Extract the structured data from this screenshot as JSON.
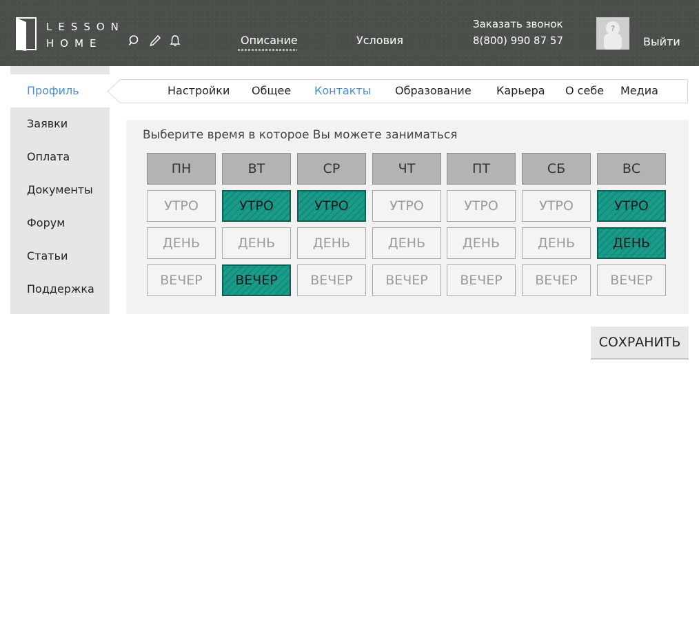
{
  "header": {
    "logo_line1": "LESSON",
    "logo_line2": "HOME",
    "icons": [
      "search-icon",
      "pencil-icon",
      "bell-icon"
    ],
    "nav": [
      "Описание",
      "Условия"
    ],
    "callback_label": "Заказать звонок",
    "phone": "8(800) 990 87 57",
    "avatar_placeholder": "?",
    "logout": "Выйти"
  },
  "sidebar": {
    "items": [
      "Профиль",
      "Заявки",
      "Оплата",
      "Документы",
      "Форум",
      "Статьи",
      "Поддержка"
    ],
    "active": "Профиль"
  },
  "tabs": {
    "items": [
      "Настройки",
      "Общее",
      "Контакты",
      "Образование",
      "Карьера",
      "О себе",
      "Медиа"
    ],
    "active": "Контакты"
  },
  "schedule": {
    "title": "Выберите время в которое Вы можете заниматься",
    "days": [
      "ПН",
      "ВТ",
      "СР",
      "ЧТ",
      "ПТ",
      "СБ",
      "ВС"
    ],
    "slots": [
      {
        "label": "УТРО",
        "selected": [
          false,
          true,
          true,
          false,
          false,
          false,
          true
        ]
      },
      {
        "label": "ДЕНЬ",
        "selected": [
          false,
          false,
          false,
          false,
          false,
          false,
          true
        ]
      },
      {
        "label": "ВЕЧЕР",
        "selected": [
          false,
          true,
          false,
          false,
          false,
          false,
          false
        ]
      }
    ]
  },
  "save_label": "СОХРАНИТЬ",
  "colors": {
    "header_bg": "#4a4f4a",
    "accent_link": "#4a90d0",
    "selected_slot": "#1a9c8a",
    "selected_border": "#0f5e52"
  }
}
